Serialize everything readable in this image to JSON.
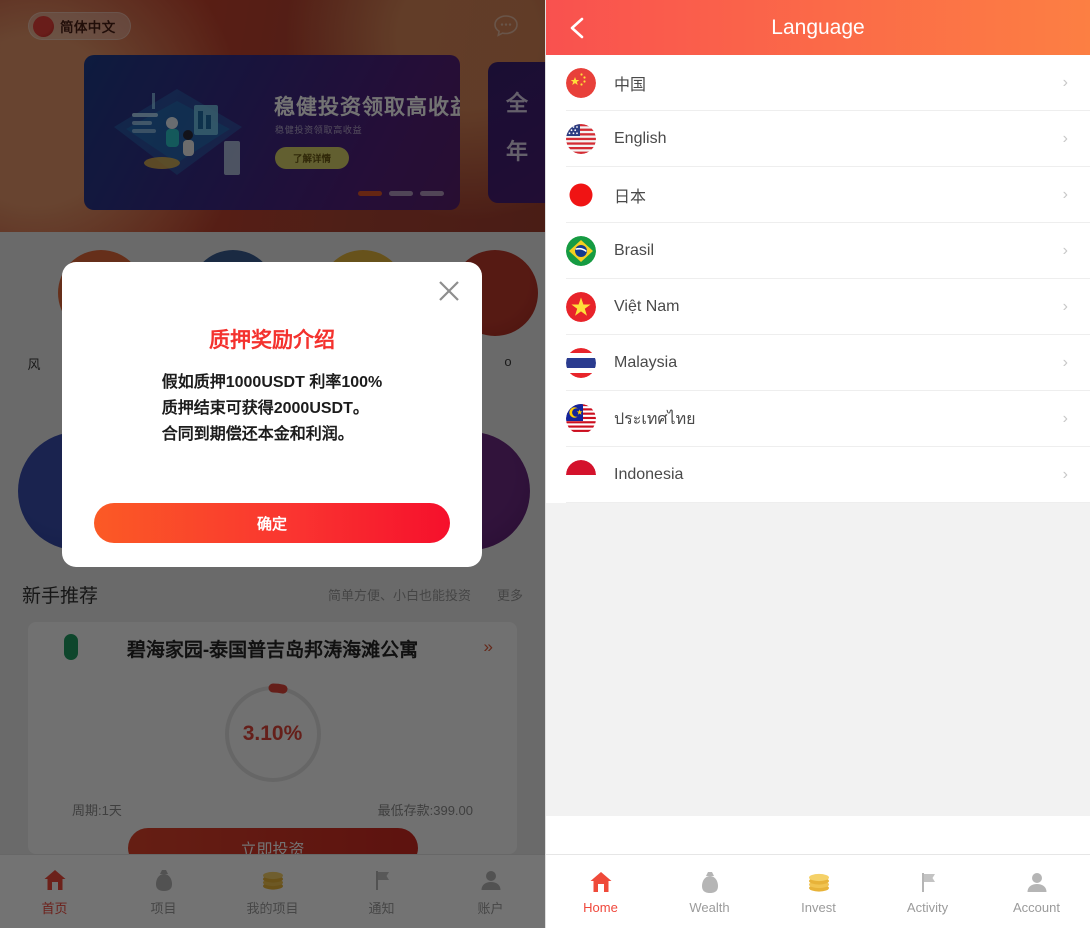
{
  "left": {
    "language_chip": {
      "label": "简体中文",
      "icon": "china-flag-icon"
    },
    "chat_icon": "chat-bubble-icon",
    "carousel": {
      "active_slide": {
        "title": "稳健投资领取高收益",
        "subtitle": "稳健投资领取高收益",
        "button": "了解详情"
      },
      "next_slide": {
        "line1": "全",
        "line2": "年"
      },
      "dots": 3,
      "active_dot_index": 0
    },
    "icon_grid": [
      {
        "label": "风",
        "color": "#c8502d"
      },
      {
        "label": "",
        "color": "#2a4a7a"
      },
      {
        "label": "",
        "color": "#d8a227"
      },
      {
        "label": "o",
        "color": "#a8291f"
      },
      {
        "label": "",
        "color": "#2f3f9c"
      },
      {
        "label": "",
        "color": "#5b1f70"
      }
    ],
    "section": {
      "title": "新手推荐",
      "subtitle": "简单方便、小白也能投资",
      "more": "更多"
    },
    "product": {
      "name": "碧海家园-泰国普吉岛邦涛海滩公寓",
      "arrow": "»",
      "rate": "3.10%",
      "period": "周期:1天",
      "min_deposit": "最低存款:399.00",
      "cta": "立即投资"
    },
    "tabbar": [
      {
        "label": "首页",
        "icon": "home-icon",
        "active": true
      },
      {
        "label": "项目",
        "icon": "money-bag-icon",
        "active": false
      },
      {
        "label": "我的项目",
        "icon": "coins-icon",
        "active": false
      },
      {
        "label": "通知",
        "icon": "flag-icon",
        "active": false
      },
      {
        "label": "账户",
        "icon": "person-icon",
        "active": false
      }
    ],
    "modal": {
      "title": "质押奖励介绍",
      "line1": "假如质押1000USDT 利率100%",
      "line2": "质押结束可获得2000USDT。",
      "line3": "合同到期偿还本金和利润。",
      "confirm": "确定",
      "close_icon": "close-icon"
    }
  },
  "right": {
    "header": {
      "title": "Language",
      "back_icon": "chevron-left-icon"
    },
    "languages": [
      {
        "name": "中国",
        "flag": "china-flag-icon",
        "chevron": "›"
      },
      {
        "name": "English",
        "flag": "usa-flag-icon",
        "chevron": "›"
      },
      {
        "name": "日本",
        "flag": "japan-flag-icon",
        "chevron": "›"
      },
      {
        "name": "Brasil",
        "flag": "brazil-flag-icon",
        "chevron": "›"
      },
      {
        "name": "Việt Nam",
        "flag": "vietnam-flag-icon",
        "chevron": "›"
      },
      {
        "name": "Malaysia",
        "flag": "thailand-flag-icon",
        "chevron": "›"
      },
      {
        "name": "ประเทศไทย",
        "flag": "malaysia-flag-icon",
        "chevron": "›"
      },
      {
        "name": "Indonesia",
        "flag": "indonesia-flag-icon",
        "chevron": "›"
      }
    ],
    "tabbar": [
      {
        "label": "Home",
        "icon": "home-icon",
        "active": true
      },
      {
        "label": "Wealth",
        "icon": "money-bag-icon",
        "active": false
      },
      {
        "label": "Invest",
        "icon": "coins-icon",
        "active": false
      },
      {
        "label": "Activity",
        "icon": "flag-icon",
        "active": false
      },
      {
        "label": "Account",
        "icon": "person-icon",
        "active": false
      }
    ]
  },
  "colors": {
    "header_gradient_start": "#F9514F",
    "header_gradient_end": "#FC7F43",
    "accent_red": "#F0483C",
    "modal_title_red": "#F4322E",
    "button_gradient_start": "#FB5A25",
    "button_gradient_end": "#F6102C"
  }
}
